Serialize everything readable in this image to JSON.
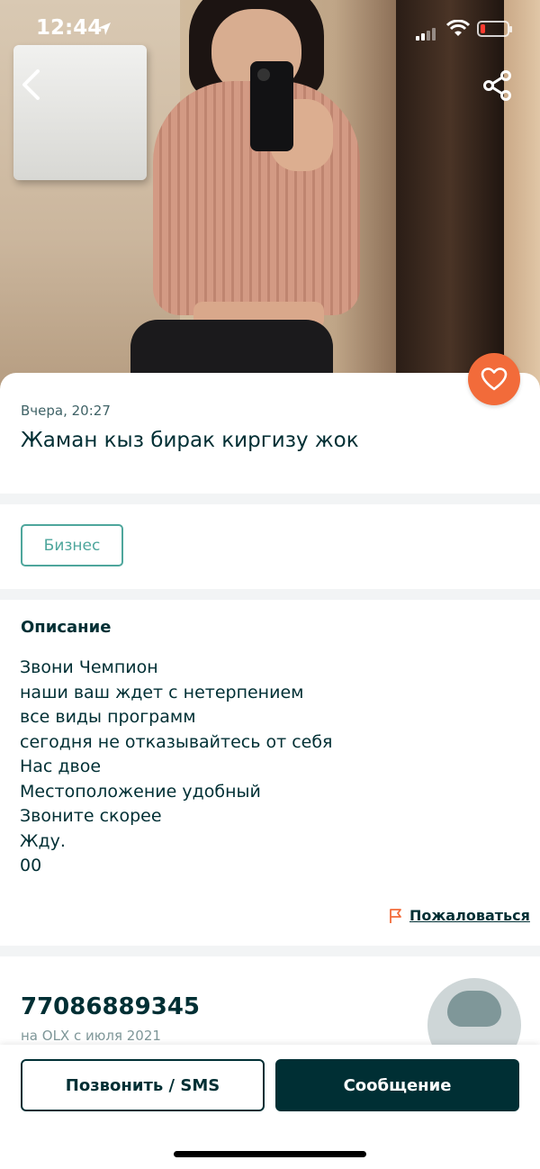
{
  "status_bar": {
    "time": "12:44"
  },
  "listing": {
    "posted": "Вчера, 20:27",
    "title": "Жаман кыз бирак киргизу жок",
    "category": "Бизнес"
  },
  "description": {
    "heading": "Описание",
    "lines": [
      "Звони Чемпион",
      "наши ваш ждет с нетерпением",
      "все виды программ",
      "сегодня не отказывайтесь от себя",
      "Нас двое",
      "Местоположение удобный",
      "Звоните скорее",
      "Жду.",
      "00"
    ]
  },
  "report": {
    "label": "Пожаловаться"
  },
  "seller": {
    "phone": "77086889345",
    "since": "на OLX с июля 2021"
  },
  "actions": {
    "call_label": "Позвонить / SMS",
    "message_label": "Сообщение"
  },
  "colors": {
    "primary": "#002f34",
    "accent": "#f26b3a",
    "category": "#4ea69c"
  },
  "icons": {
    "back": "chevron-left-icon",
    "share": "share-icon",
    "favorite": "heart-icon",
    "report": "flag-icon"
  }
}
